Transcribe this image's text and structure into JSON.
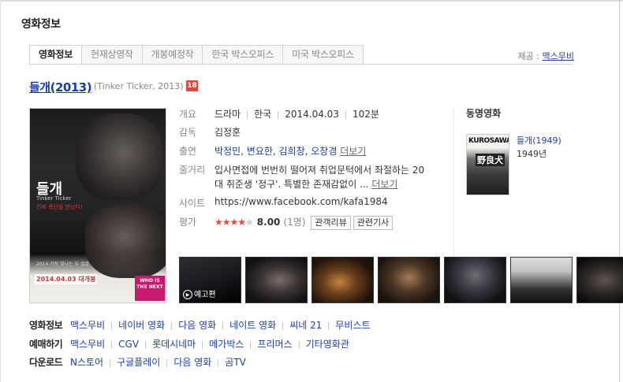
{
  "section_title": "영화정보",
  "tabs": [
    {
      "label": "영화정보",
      "active": true
    },
    {
      "label": "현재상영작",
      "active": false
    },
    {
      "label": "개봉예정작",
      "active": false
    },
    {
      "label": "한국 박스오피스",
      "active": false
    },
    {
      "label": "미국 박스오피스",
      "active": false
    }
  ],
  "provider": {
    "label": "제공 : ",
    "link": "맥스무비"
  },
  "movie": {
    "title": "들개(2013)",
    "subtitle": "(Tinker Ticker, 2013)",
    "age_rating": "18",
    "overview": {
      "label": "개요",
      "genre": "드라마",
      "country": "한국",
      "release": "2014.04.03",
      "runtime": "102분"
    },
    "director": {
      "label": "감독",
      "name": "김정훈"
    },
    "cast": {
      "label": "출연",
      "names": "박정민, 변요한, 김희창, 오창경",
      "more": "더보기"
    },
    "plot": {
      "label": "줄거리",
      "line1": "입사면접에 번번히 떨어져 취업문턱에서 좌절하는 20",
      "line2": "대 취준생 '정구'. 특별한 존재감없이 ...",
      "more": "더보기"
    },
    "site": {
      "label": "사이트",
      "url": "https://www.facebook.com/kafa1984"
    },
    "rating": {
      "label": "평가",
      "stars_on": "★★★★",
      "stars_off": "★",
      "score_value": 4,
      "score_max": 5,
      "score": "8.00",
      "count": "(1명)",
      "buttons": [
        "관객리뷰",
        "관련기사"
      ]
    }
  },
  "poster": {
    "title": "들개",
    "en_title": "Tinker Ticker",
    "tagline": "진짜 폭탄을 만났다!",
    "bottom_line": "2014 가장 빛나는 두 얼굴",
    "date": "2014.04.03 대개봉",
    "badge": "WHO IS THE NEXT"
  },
  "same_name": {
    "title": "동명영화",
    "poster_text": "KUROSAWA",
    "poster_kanji": "野良犬",
    "name": "들개(1949)",
    "year": "1949년"
  },
  "thumbnails": [
    {
      "label": "예고편",
      "icon": "play-icon"
    },
    {
      "label": ""
    },
    {
      "label": ""
    },
    {
      "label": ""
    },
    {
      "label": ""
    },
    {
      "label": ""
    },
    {
      "label": ""
    }
  ],
  "link_rows": [
    {
      "label": "영화정보",
      "items": [
        "맥스무비",
        "네이버 영화",
        "다음 영화",
        "네이트 영화",
        "씨네 21",
        "무비스트"
      ]
    },
    {
      "label": "예매하기",
      "items": [
        "맥스무비",
        "CGV",
        "롯데시네마",
        "메가박스",
        "프리머스",
        "기타영화관"
      ]
    },
    {
      "label": "다운로드",
      "items": [
        "N스토어",
        "구글플레이",
        "다음 영화",
        "곰TV"
      ]
    }
  ]
}
